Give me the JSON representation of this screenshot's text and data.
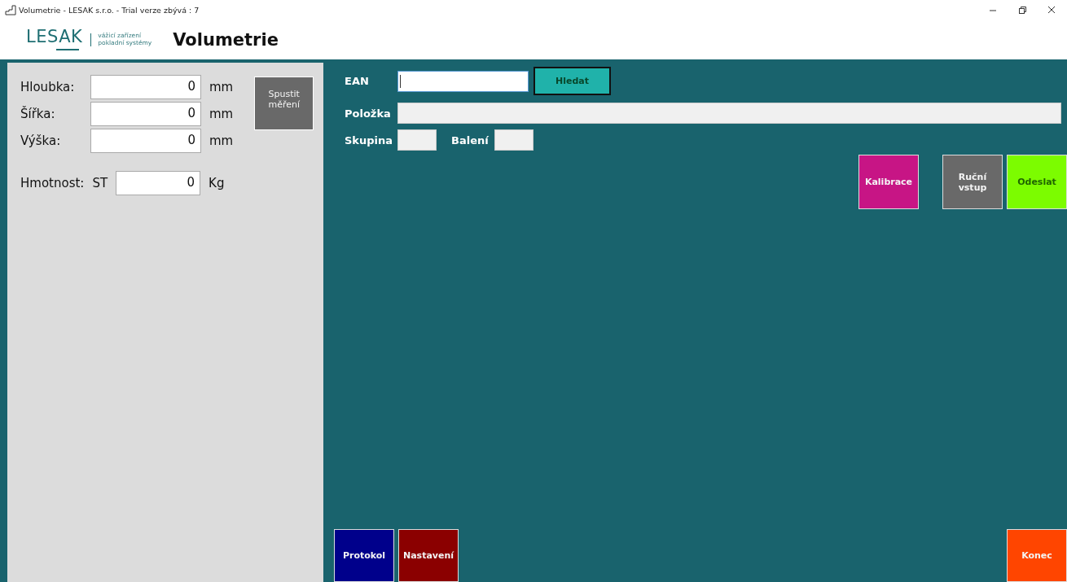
{
  "window": {
    "title": "Volumetrie - LESAK s.r.o. - Trial verze zbývá : 7"
  },
  "header": {
    "logo": "LESAK",
    "tagline": [
      "vážicí zařízení",
      "pokladní systémy"
    ],
    "title": "Volumetrie"
  },
  "measurements": [
    {
      "label": "Hloubka:",
      "value": "0",
      "unit": "mm"
    },
    {
      "label": "Šířka:",
      "value": "0",
      "unit": "mm"
    },
    {
      "label": "Výška:",
      "value": "0",
      "unit": "mm"
    }
  ],
  "weight": {
    "label": "Hmotnost:",
    "scale": "ST",
    "value": "0",
    "unit": "Kg"
  },
  "start_button": {
    "label": "Spustit měření",
    "color": "#696969"
  },
  "search": {
    "label": "EAN",
    "focused": true,
    "button": {
      "label": "Hledat",
      "color": "#20b2aa"
    }
  },
  "item": {
    "label": "Položka",
    "readonly": true
  },
  "group": {
    "label": "Skupina",
    "readonly": true
  },
  "package": {
    "label": "Balení",
    "readonly": true
  },
  "action_buttons": [
    {
      "label": "Kalibrace",
      "color": "#c71585"
    },
    {
      "label": "Ruční vstup",
      "color": "#696969"
    },
    {
      "label": "Odeslat",
      "color": "#7cfc00"
    }
  ],
  "bottom_buttons": [
    {
      "label": "Protokol",
      "color": "#00008b"
    },
    {
      "label": "Nastavení",
      "color": "#8b0000"
    },
    {
      "label": "Konec",
      "color": "#ff4500"
    }
  ]
}
